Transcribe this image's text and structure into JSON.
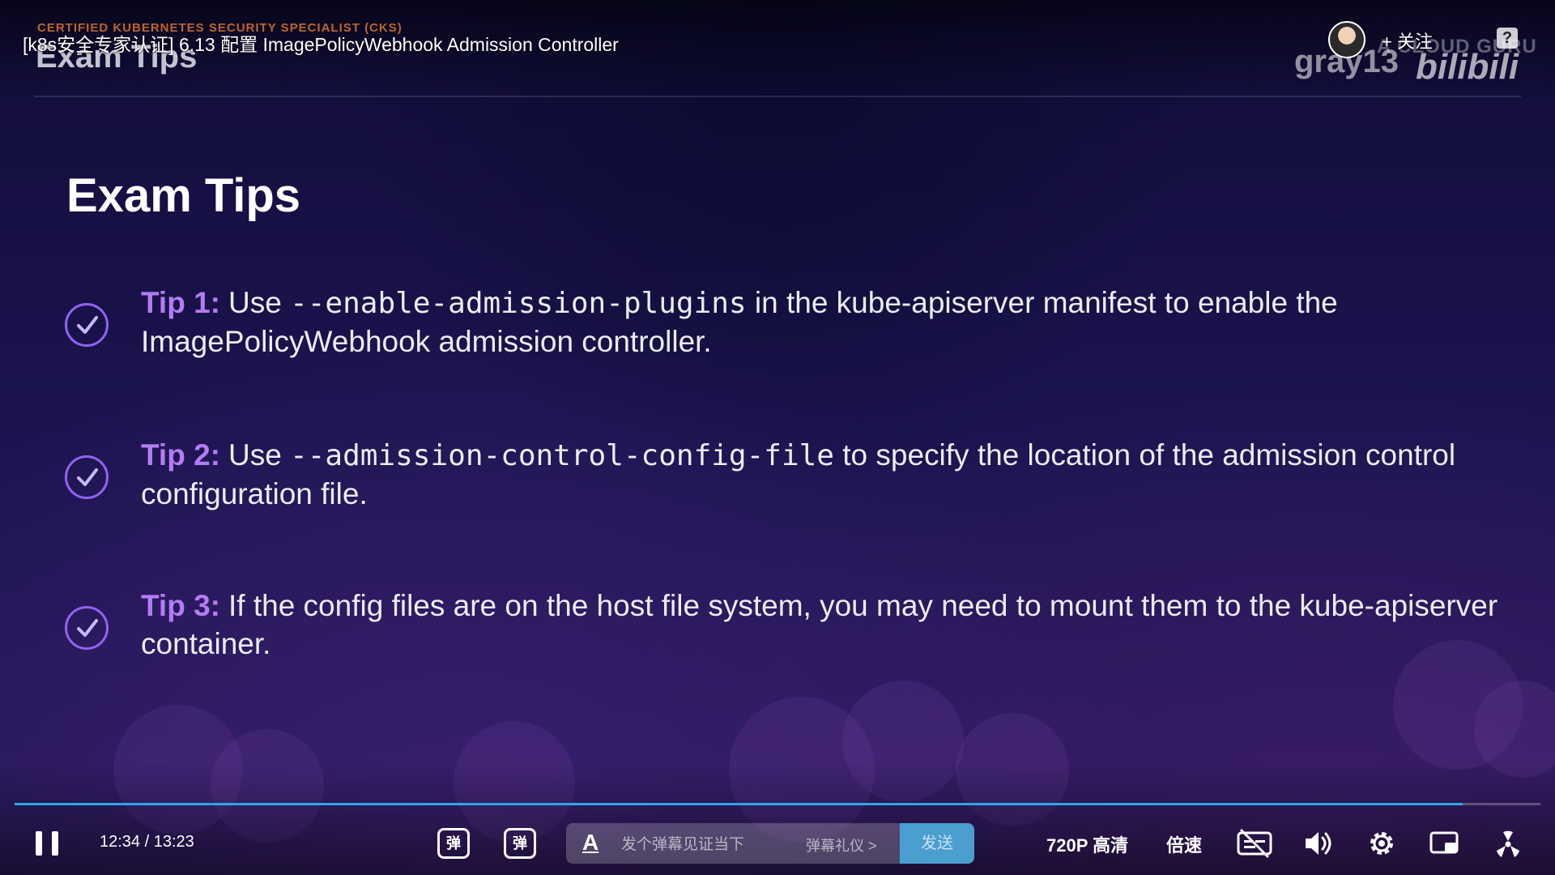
{
  "player": {
    "video_title": "[k8s安全专家认证] 6.13 配置 ImagePolicyWebhook Admission Controller",
    "follow_label": "+ 关注",
    "help_icon": "question-icon",
    "avatar_icon": "avatar"
  },
  "slide": {
    "course_tag": "CERTIFIED KUBERNETES SECURITY SPECIALIST (CKS)",
    "header_title": "Exam Tips",
    "title": "Exam Tips",
    "watermark_user": "gray13",
    "watermark_brand": "A CLOUD GURU",
    "watermark_site": "bilibili",
    "accent_color": "#b47cf2",
    "tips": [
      {
        "label": "Tip 1:",
        "pre": "Use ",
        "code": "--enable-admission-plugins",
        "post": " in the kube-apiserver manifest to enable the ImagePolicyWebhook admission controller."
      },
      {
        "label": "Tip 2:",
        "pre": "Use ",
        "code": "--admission-control-config-file",
        "post": " to specify the location of the admission control configuration file."
      },
      {
        "label": "Tip 3:",
        "pre": "If the config files are on the host file system, you may need to mount them to the kube-apiserver container.",
        "code": "",
        "post": ""
      }
    ]
  },
  "controls": {
    "current_time": "12:34",
    "separator": "/",
    "total_time": "13:23",
    "progress_fraction": 0.949,
    "danmaku_toggle_label": "弹",
    "danmaku_settings_label": "弹",
    "danmaku_font_icon": "A",
    "danmaku_placeholder": "发个弹幕见证当下",
    "danmaku_etiquette": "弹幕礼仪 >",
    "send_label": "发送",
    "quality_label": "720P 高清",
    "speed_label": "倍速",
    "icons": [
      "pause-icon",
      "danmaku-toggle-icon",
      "danmaku-settings-icon",
      "subtitle-off-icon",
      "volume-icon",
      "settings-icon",
      "pip-icon",
      "fullscreen-icon"
    ]
  }
}
